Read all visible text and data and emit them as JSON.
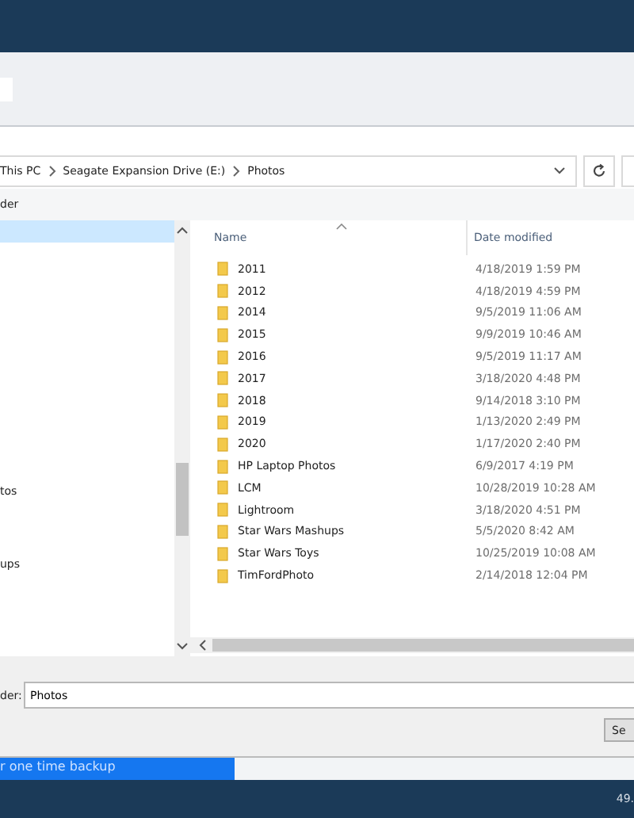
{
  "address_bar": {
    "path": [
      {
        "label": "This PC"
      },
      {
        "label": "Seagate Expansion Drive (E:)"
      },
      {
        "label": "Photos"
      }
    ]
  },
  "toolbar": {
    "label": "der"
  },
  "nav_pane": {
    "items": [
      {
        "selected": true
      },
      {
        "label": "tos",
        "selected": false
      },
      {
        "label": "ups",
        "selected": false
      }
    ]
  },
  "file_list": {
    "columns": [
      "Name",
      "Date modified"
    ],
    "rows": [
      {
        "name": "2011",
        "date": "4/18/2019 1:59 PM"
      },
      {
        "name": "2012",
        "date": "4/18/2019 4:59 PM"
      },
      {
        "name": "2014",
        "date": "9/5/2019 11:06 AM"
      },
      {
        "name": "2015",
        "date": "9/9/2019 10:46 AM"
      },
      {
        "name": "2016",
        "date": "9/5/2019 11:17 AM"
      },
      {
        "name": "2017",
        "date": "3/18/2020 4:48 PM"
      },
      {
        "name": "2018",
        "date": "9/14/2018 3:10 PM"
      },
      {
        "name": "2019",
        "date": "1/13/2020 2:49 PM"
      },
      {
        "name": "2020",
        "date": "1/17/2020 2:40 PM"
      },
      {
        "name": "HP Laptop Photos",
        "date": "6/9/2017 4:19 PM"
      },
      {
        "name": "LCM",
        "date": "10/28/2019 10:28 AM"
      },
      {
        "name": "Lightroom",
        "date": "3/18/2020 4:51 PM"
      },
      {
        "name": "Star Wars Mashups",
        "date": "5/5/2020 8:42 AM"
      },
      {
        "name": "Star Wars Toys",
        "date": "10/25/2019 10:08 AM"
      },
      {
        "name": "TimFordPhoto",
        "date": "2/14/2018 12:04 PM"
      }
    ]
  },
  "folder_field": {
    "label": "der:",
    "value": "Photos"
  },
  "buttons": [
    "Se"
  ],
  "backup_progress": {
    "text": "r one time backup",
    "level": 0.37
  },
  "footer": {
    "text": "49."
  }
}
